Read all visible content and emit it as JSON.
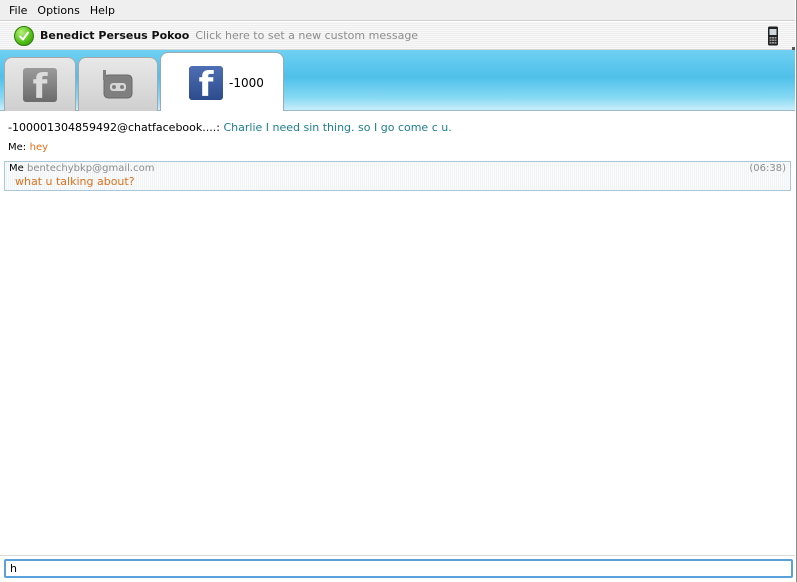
{
  "menu": {
    "items": [
      "File",
      "Options",
      "Help"
    ]
  },
  "status": {
    "name": "Benedict Perseus Pokoo",
    "custom_message": "Click here to set a new custom message",
    "status_icon": "check-icon",
    "status_color": "#57c21a"
  },
  "tabs": [
    {
      "icon": "facebook-icon",
      "label": ""
    },
    {
      "icon": "chat-bubble-icon",
      "label": ""
    },
    {
      "icon": "facebook-icon",
      "label": "-1000"
    }
  ],
  "chat": {
    "incoming": {
      "sender": "-100001304859492@chatfacebook....:",
      "text": "Charlie I need sin thing. so I go come c u."
    },
    "outgoing_simple": {
      "label": "Me:",
      "text": "hey"
    },
    "block": {
      "me": "Me",
      "email": "bentechybkp@gmail.com",
      "time": "(06:38)",
      "text": "what u talking about?"
    }
  },
  "input": {
    "value": "h"
  },
  "colors": {
    "accent": "#4fc0ea",
    "incoming_text": "#1c7f8c",
    "outgoing_text": "#e1701a"
  }
}
